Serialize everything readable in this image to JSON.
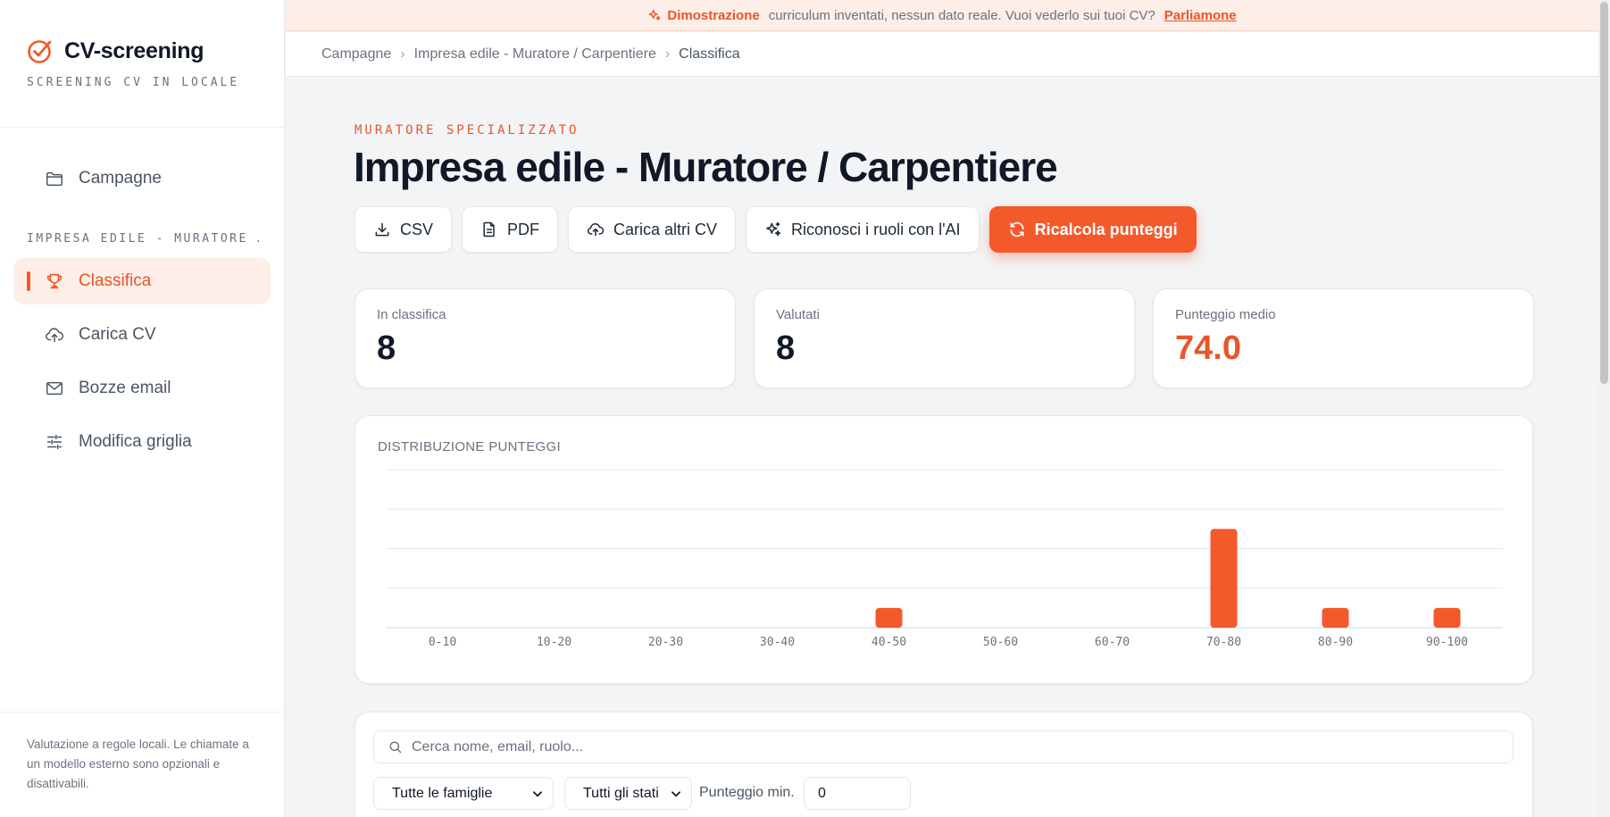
{
  "app": {
    "name": "CV-screening",
    "tagline": "SCREENING CV IN LOCALE",
    "brand_color": "#f4592c"
  },
  "sidebar": {
    "campaigns_label": "Campagne",
    "section_label": "IMPRESA EDILE - MURATORE …",
    "items": [
      {
        "label": "Classifica",
        "icon": "trophy-icon",
        "active": true
      },
      {
        "label": "Carica CV",
        "icon": "cloud-upload-icon"
      },
      {
        "label": "Bozze email",
        "icon": "mail-icon"
      },
      {
        "label": "Modifica griglia",
        "icon": "sliders-icon"
      }
    ],
    "footer": "Valutazione a regole locali. Le chiamate a un modello esterno sono opzionali e disattivabili."
  },
  "banner": {
    "label": "Dimostrazione",
    "text": "curriculum inventati, nessun dato reale. Vuoi vederlo sui tuoi CV?",
    "link": "Parliamone"
  },
  "breadcrumb": [
    "Campagne",
    "Impresa edile - Muratore / Carpentiere",
    "Classifica"
  ],
  "header": {
    "eyebrow": "MURATORE SPECIALIZZATO",
    "title": "Impresa edile - Muratore / Carpentiere"
  },
  "actions": {
    "csv": "CSV",
    "pdf": "PDF",
    "upload": "Carica altri CV",
    "ai_roles": "Riconosci i ruoli con l'AI",
    "recalc": "Ricalcola punteggi"
  },
  "stats": [
    {
      "label": "In classifica",
      "value": "8"
    },
    {
      "label": "Valutati",
      "value": "8"
    },
    {
      "label": "Punteggio medio",
      "value": "74.0"
    }
  ],
  "chart_data": {
    "type": "bar",
    "title": "DISTRIBUZIONE PUNTEGGI",
    "categories": [
      "0-10",
      "10-20",
      "20-30",
      "30-40",
      "40-50",
      "50-60",
      "60-70",
      "70-80",
      "80-90",
      "90-100"
    ],
    "values": [
      0,
      0,
      0,
      0,
      1,
      0,
      0,
      5,
      1,
      1
    ],
    "ylim": [
      0,
      8
    ],
    "grid": true,
    "bar_color": "#f4592c"
  },
  "filters": {
    "search_placeholder": "Cerca nome, email, ruolo...",
    "family": "Tutte le famiglie",
    "status": "Tutti gli stati",
    "min_label": "Punteggio min.",
    "min_value": "0"
  }
}
